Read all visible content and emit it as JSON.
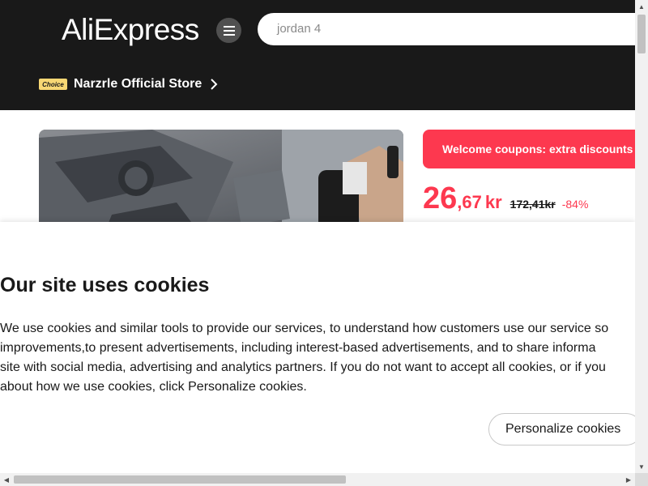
{
  "header": {
    "logo": "AliExpress",
    "search_value": "jordan 4",
    "choice_badge": "Choice",
    "store_name": "Narzrle Official Store"
  },
  "product": {
    "coupon_text": "Welcome coupons: extra discounts",
    "price_integer": "26",
    "price_decimal": ",67",
    "price_currency": "kr",
    "original_price": "172,41kr",
    "discount": "-84%"
  },
  "cookie_banner": {
    "title": "Our site uses cookies",
    "body_lines": [
      "We use cookies and similar tools to provide our services, to understand how customers use our service so",
      "improvements,to present advertisements, including interest-based advertisements, and to share informa",
      "site with social media, advertising and analytics partners. If you do not want to accept all cookies, or if you",
      "about how we use cookies, click Personalize cookies."
    ],
    "personalize_button": "Personalize cookies"
  },
  "scrollbars": {
    "up_arrow": "▲",
    "down_arrow": "▼",
    "left_arrow": "◀",
    "right_arrow": "▶"
  },
  "colors": {
    "header_bg": "#191919",
    "accent_red": "#fd384f",
    "choice_yellow": "#f7d774"
  }
}
